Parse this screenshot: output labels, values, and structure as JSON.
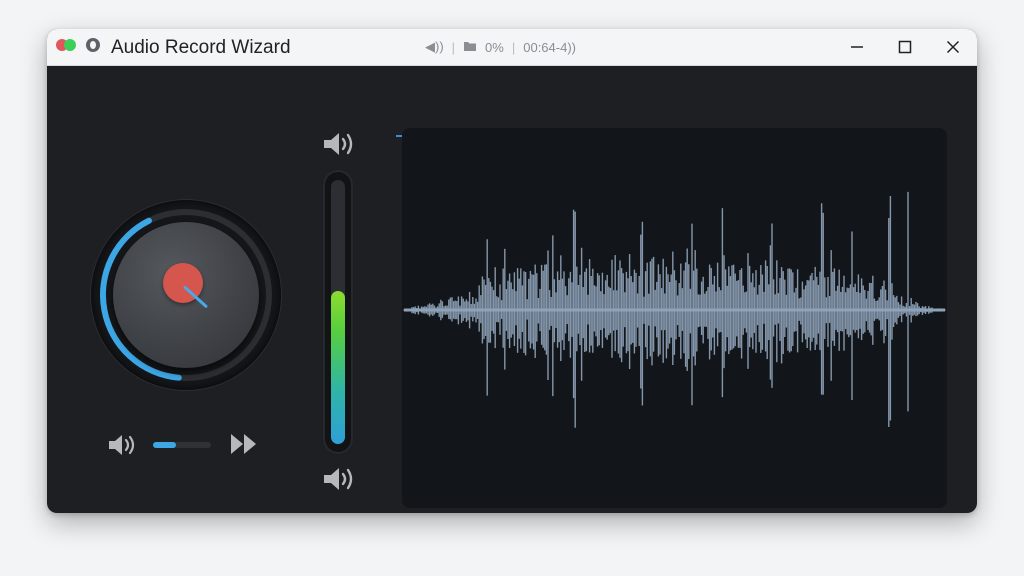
{
  "window": {
    "title": "Audio Record Wizard"
  },
  "titlebar": {
    "status": [
      {
        "name": "speaker-status-text",
        "text": "◀))"
      },
      {
        "name": "folder-status-text",
        "text": "▬"
      },
      {
        "name": "percent-status-text",
        "text": "0%"
      },
      {
        "name": "time-status-text",
        "text": "00:64-4))"
      }
    ]
  },
  "recorder": {
    "knob_level": 0.55,
    "playback_level": 0.4,
    "input_meter_level": 0.58
  },
  "colors": {
    "accent": "#3da7e6",
    "record": "#d5564d",
    "waveform": "#8ea2b8",
    "window_bg": "#1d1f22"
  },
  "icons": [
    "speaker-icon",
    "fast-forward-icon",
    "record-icon",
    "minimize-icon",
    "maximize-icon",
    "close-icon",
    "folder-icon"
  ]
}
